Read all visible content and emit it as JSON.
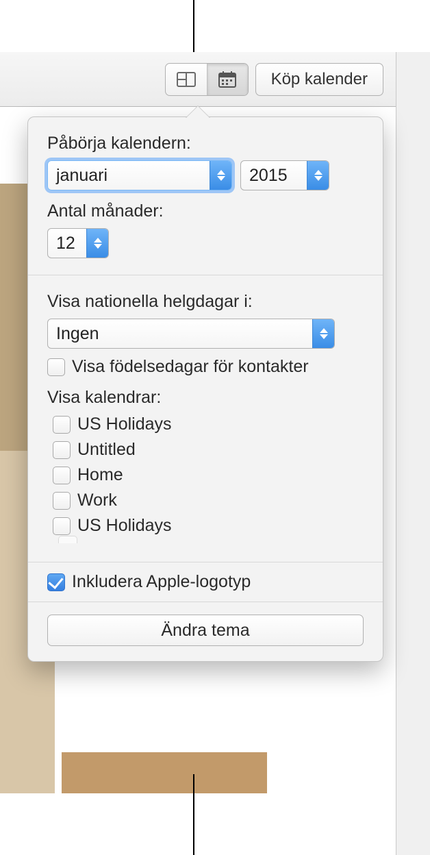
{
  "toolbar": {
    "buy_label": "Köp kalender"
  },
  "popover": {
    "start_label": "Påbörja kalendern:",
    "start_month": "januari",
    "start_year": "2015",
    "months_label": "Antal månader:",
    "months_value": "12",
    "holidays_label": "Visa nationella helgdagar i:",
    "holidays_value": "Ingen",
    "birthdays_label": "Visa födelsedagar för kontakter",
    "calendars_label": "Visa kalendrar:",
    "calendars": [
      {
        "label": "US Holidays"
      },
      {
        "label": "Untitled"
      },
      {
        "label": "Home"
      },
      {
        "label": "Work"
      },
      {
        "label": "US Holidays"
      }
    ],
    "include_logo_label": "Inkludera Apple-logotyp",
    "change_theme_label": "Ändra tema"
  }
}
